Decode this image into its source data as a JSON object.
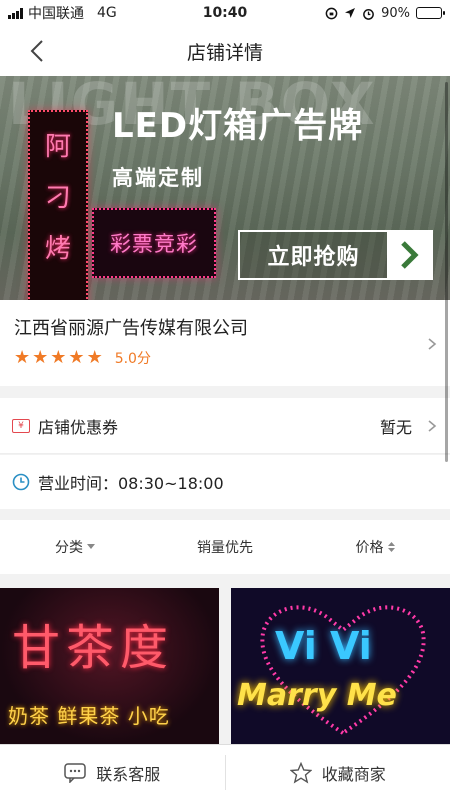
{
  "status_bar": {
    "carrier": "中国联通",
    "network": "4G",
    "time": "10:40",
    "battery_text": "90%",
    "battery_level": 0.9
  },
  "nav": {
    "title": "店铺详情",
    "back_icon": "chevron-left-icon"
  },
  "banner": {
    "background_word": "LIGHT BOX",
    "heading": "LED灯箱广告牌",
    "subheading": "高端定制",
    "cta": "立即抢购",
    "sign_one_text": "阿刁烤",
    "sign_two_text": "彩票竞彩",
    "slide_count": 3,
    "active_slide": 2
  },
  "shop": {
    "name": "江西省丽源广告传媒有限公司",
    "stars": 5,
    "score": "5.0分",
    "accent_color": "#f07a26"
  },
  "coupon": {
    "icon_text": "¥",
    "label": "店铺优惠券",
    "value": "暂无"
  },
  "hours": {
    "label": "营业时间：08:30~18:00"
  },
  "sort": {
    "category": "分类",
    "sales": "销量优先",
    "price": "价格"
  },
  "products": [
    {
      "sign_text": "甘茶度",
      "sign_subtext": "奶茶 鲜果茶 小吃"
    },
    {
      "sign_text": "Vi Vi",
      "sign_subtext": "Marry Me"
    }
  ],
  "bottom_bar": {
    "service": "联系客服",
    "favorite": "收藏商家"
  }
}
